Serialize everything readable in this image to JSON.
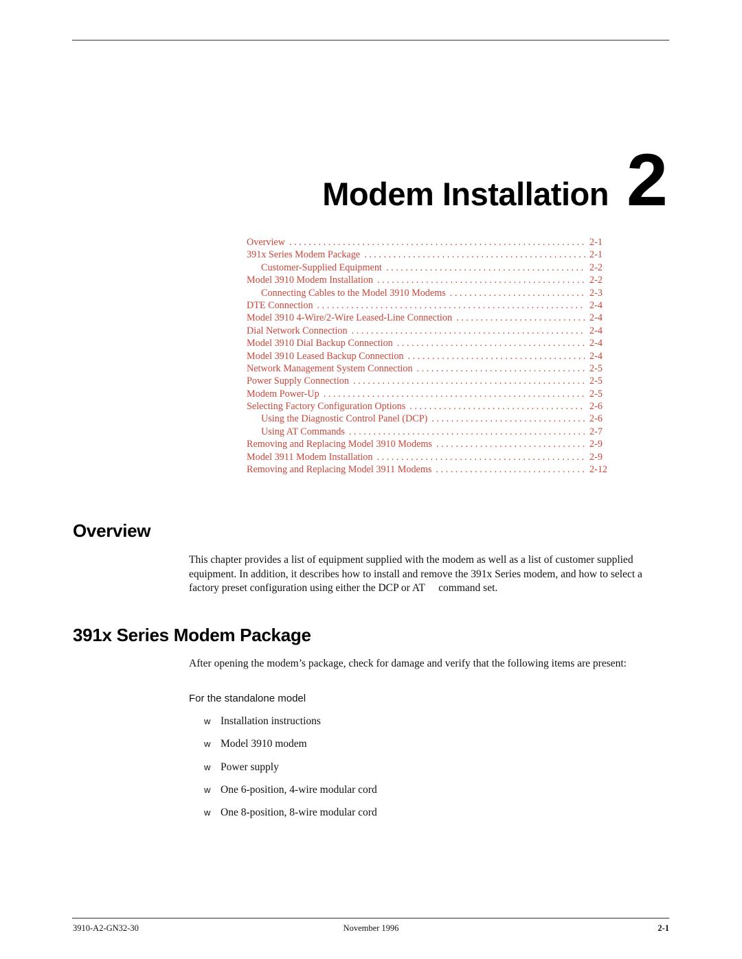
{
  "chapter": {
    "title": "Modem Installation",
    "number": "2"
  },
  "toc": [
    {
      "label": "Overview",
      "page": "2-1",
      "level": 1
    },
    {
      "label": "391x Series Modem Package",
      "page": "2-1",
      "level": 1
    },
    {
      "label": "Customer-Supplied Equipment",
      "page": "2-2",
      "level": 2
    },
    {
      "label": "Model 3910 Modem Installation",
      "page": "2-2",
      "level": 1
    },
    {
      "label": "Connecting Cables to the Model 3910 Modems",
      "page": "2-3",
      "level": 2
    },
    {
      "label": "DTE Connection",
      "page": "2-4",
      "level": 1
    },
    {
      "label": "Model 3910 4-Wire/2-Wire Leased-Line Connection",
      "page": "2-4",
      "level": 1
    },
    {
      "label": "Dial Network Connection",
      "page": "2-4",
      "level": 1
    },
    {
      "label": "Model 3910 Dial Backup Connection",
      "page": "2-4",
      "level": 1
    },
    {
      "label": "Model 3910 Leased Backup Connection",
      "page": "2-4",
      "level": 1
    },
    {
      "label": "Network Management System Connection",
      "page": "2-5",
      "level": 1
    },
    {
      "label": "Power Supply Connection",
      "page": "2-5",
      "level": 1
    },
    {
      "label": "Modem Power-Up",
      "page": "2-5",
      "level": 1
    },
    {
      "label": "Selecting Factory Configuration Options",
      "page": "2-6",
      "level": 1
    },
    {
      "label": "Using the Diagnostic Control Panel (DCP)",
      "page": "2-6",
      "level": 2
    },
    {
      "label": "Using AT Commands",
      "page": "2-7",
      "level": 2
    },
    {
      "label": "Removing and Replacing Model 3910 Modems",
      "page": "2-9",
      "level": 1
    },
    {
      "label": "Model 3911 Modem Installation",
      "page": "2-9",
      "level": 1
    },
    {
      "label": "Removing and Replacing Model 3911 Modems",
      "page": "2-12",
      "level": 1
    }
  ],
  "sections": {
    "overview": {
      "heading": "Overview",
      "body": "This chapter provides a list of equipment supplied with the modem as well as a list of customer supplied equipment. In addition, it describes how to install and remove the 391x Series modem, and how to select a factory preset configuration using either the DCP or AT  command set."
    },
    "package": {
      "heading": "391x Series Modem Package",
      "body": "After opening the modem’s package, check for damage and verify that the following items are present:",
      "subheading": "For the standalone model",
      "bullet_glyph": "w",
      "items": [
        "Installation instructions",
        "Model 3910 modem",
        "Power supply",
        "One 6-position, 4-wire modular cord",
        "One 8-position, 8-wire modular cord"
      ]
    }
  },
  "footer": {
    "doc_number": "3910-A2-GN32-30",
    "date": "November 1996",
    "page": "2-1"
  },
  "colors": {
    "toc_link": "#c8463a"
  }
}
